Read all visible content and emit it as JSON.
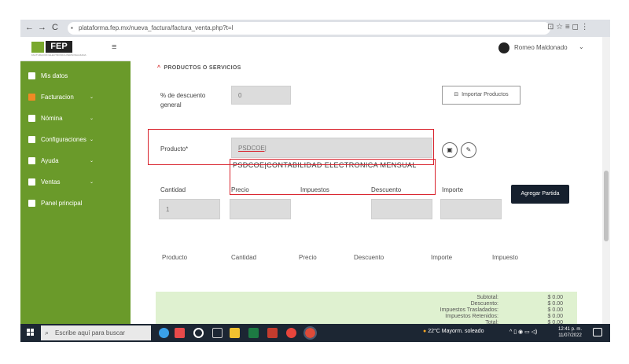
{
  "browser": {
    "url": "plataforma.fep.mx/nueva_factura/factura_venta.php?t=l",
    "back": "←",
    "forward": "→",
    "reload": "C",
    "right_icons": "⊡  ☆  ≡  ◻  ⋮"
  },
  "logo": {
    "text": "FEP",
    "subtitle": "FACTURACION ELECTRONICA PERSONALIZADA"
  },
  "sidebar": {
    "items": [
      {
        "label": "Mis datos",
        "chevron": ""
      },
      {
        "label": "Facturacion",
        "chevron": "⌄"
      },
      {
        "label": "Nómina",
        "chevron": "⌄"
      },
      {
        "label": "Configuraciones",
        "chevron": "⌄"
      },
      {
        "label": "Ayuda",
        "chevron": "⌄"
      },
      {
        "label": "Ventas",
        "chevron": "⌄"
      },
      {
        "label": "Panel principal",
        "chevron": ""
      }
    ]
  },
  "header": {
    "user_name": "Romeo Maldonado",
    "menu_icon": "≡",
    "user_chevron": "⌄"
  },
  "section": {
    "caret": "^",
    "title": "PRODUCTOS O SERVICIOS",
    "discount_label_1": "% de descuento",
    "discount_label_2": "general",
    "discount_value": "0",
    "import_button": "Importar Productos",
    "product_label": "Producto*",
    "product_value": "PSDCOE|",
    "suggestion": "PSDCOE|CONTABILIDAD ELECTRONICA MENSUAL",
    "qty_label": "Cantidad",
    "price_label": "Precio",
    "tax_label": "Impuestos",
    "discount_col_label": "Descuento",
    "amount_label": "Importe",
    "qty_value": "1",
    "add_button": "Agregar Partida"
  },
  "table": {
    "headers": [
      "Producto",
      "Cantidad",
      "Precio",
      "Descuento",
      "Importe",
      "Impuesto"
    ]
  },
  "totals": {
    "rows": [
      {
        "label": "Subtotal:",
        "value": "$ 0.00"
      },
      {
        "label": "Descuento:",
        "value": "$ 0.00"
      },
      {
        "label": "Impuestos Trasladados:",
        "value": "$ 0.00"
      },
      {
        "label": "Impuestos Retenidos:",
        "value": "$ 0.00"
      },
      {
        "label": "Total:",
        "value": "$ 0.00"
      }
    ]
  },
  "taskbar": {
    "search_placeholder": "Escribe aquí para buscar",
    "weather": "22°C  Mayorm. soleado",
    "time": "12:41 p. m.",
    "date": "11/07/2022",
    "colors": {
      "bg": "#1c2633"
    }
  },
  "colors": {
    "sidebar": "#6a9a2a",
    "highlight": "#d9232d",
    "totals_bg": "#dff1d0",
    "dark_button": "#16202e"
  }
}
